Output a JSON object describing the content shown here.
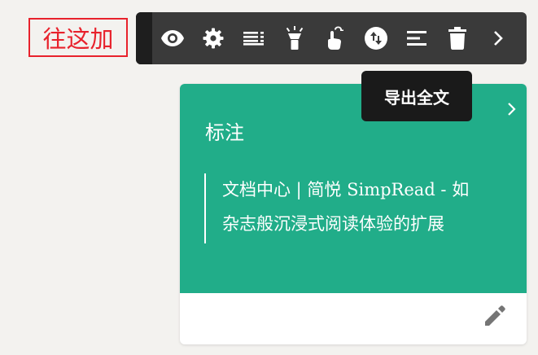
{
  "annotation": {
    "text": "往这加",
    "color": "#e8222c"
  },
  "toolbar": {
    "background": "#3a3a3a",
    "buttons": [
      {
        "icon": "eye-icon"
      },
      {
        "icon": "gear-icon"
      },
      {
        "icon": "list-icon"
      },
      {
        "icon": "flashlight-icon"
      },
      {
        "icon": "touch-icon"
      },
      {
        "icon": "export-icon"
      },
      {
        "icon": "align-left-icon"
      },
      {
        "icon": "trash-icon"
      },
      {
        "icon": "chevron-right-icon"
      }
    ]
  },
  "tooltip": {
    "text": "导出全文"
  },
  "card": {
    "accent": "#21ad89",
    "title": "标注",
    "quote_lines": [
      "文档中心 | 简悦 SimpRead - 如",
      "杂志般沉浸式阅读体验的扩展"
    ]
  }
}
